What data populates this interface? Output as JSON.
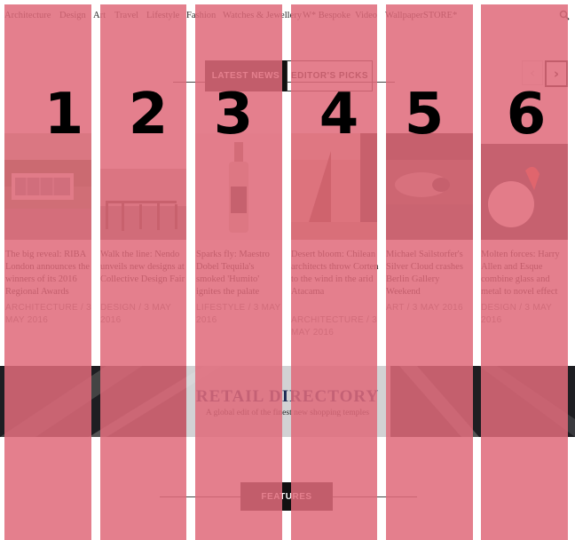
{
  "nav": {
    "items": [
      "Architecture",
      "Design",
      "Art",
      "Travel",
      "Lifestyle",
      "Fashion",
      "Watches & Jewellery",
      "W* Bespoke",
      "Video",
      "WallpaperSTORE*"
    ],
    "search_icon": "search-icon"
  },
  "tabs": {
    "latest": "LATEST NEWS",
    "picks": "EDITOR'S PICKS"
  },
  "carousel": {
    "prev_icon": "‹",
    "next_icon": "›"
  },
  "articles": [
    {
      "number": "1",
      "title": "The big reveal: RIBA London announces the winners of its 2016 Regional Awards",
      "meta": "ARCHITECTURE / 3 MAY 2016"
    },
    {
      "number": "2",
      "title": "Walk the line: Nendo unveils new designs at Collective Design Fair",
      "meta": "DESIGN / 3 MAY 2016"
    },
    {
      "number": "3",
      "title": "Sparks fly: Maestro Dobel Tequila's smoked 'Humito' ignites the palate",
      "meta": "LIFESTYLE / 3 MAY 2016"
    },
    {
      "number": "4",
      "title": "Desert bloom: Chilean architects throw Corten to the wind in the arid Atacama",
      "meta": "ARCHITECTURE / 3 MAY 2016"
    },
    {
      "number": "5",
      "title": "Michael Sailstorfer's Silver Cloud crashes Berlin Gallery Weekend",
      "meta": "ART / 3 MAY 2016"
    },
    {
      "number": "6",
      "title": "Molten forces: Harry Allen and Esque combine glass and metal to novel effect",
      "meta": "DESIGN / 3 MAY 2016"
    }
  ],
  "banner": {
    "title": "RETAIL DIRECTORY",
    "subtitle": "A global edit of the finest new shopping temples"
  },
  "features": {
    "label": "FEATURES"
  },
  "colors": {
    "overlay": "#e06a7a",
    "nav_text": "#222222",
    "banner_title": "#1e2b55"
  }
}
